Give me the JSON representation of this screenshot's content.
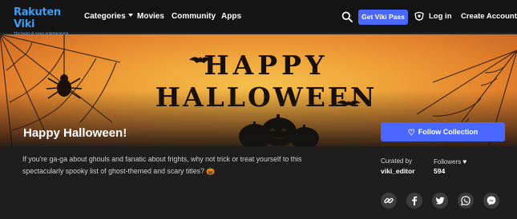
{
  "brand": {
    "name_part1": "Rakuten",
    "name_part2": "Viki",
    "tagline": "The heart of Asian entertainment",
    "color": "#3d9cf0"
  },
  "nav": {
    "categories_label": "Categories",
    "movies_label": "Movies",
    "community_label": "Community",
    "apps_label": "Apps",
    "search_icon": "search-icon",
    "pass_label": "Get Viki Pass",
    "pass_color": "#4a68ff",
    "login_icon": "user-badge-icon",
    "login_label": "Log in",
    "create_account_label": "Create Account"
  },
  "hero": {
    "banner_text_line1": "HAPPY",
    "banner_text_line2": "HALLOWEEN",
    "title": "Happy Halloween!",
    "follow_label": "Follow Collection",
    "follow_icon": "heart-icon"
  },
  "collection": {
    "description": "If you're ga-ga about ghouls and fanatic about frights, why not trick or treat yourself to this spectacularly spooky list of ghost-themed and scary titles? 🎃",
    "curated_by_label": "Curated by",
    "curator": "viki_editor",
    "followers_label": "Followers",
    "followers_count": "594"
  },
  "share": {
    "icons": [
      "link-icon",
      "facebook-icon",
      "twitter-icon",
      "whatsapp-icon",
      "messenger-icon"
    ]
  },
  "colors": {
    "background": "#1e1e1e",
    "nav_background": "#141414",
    "accent": "#4a68ff",
    "hero_orange": "#efa33a",
    "share_circle": "#3c3c3c"
  }
}
